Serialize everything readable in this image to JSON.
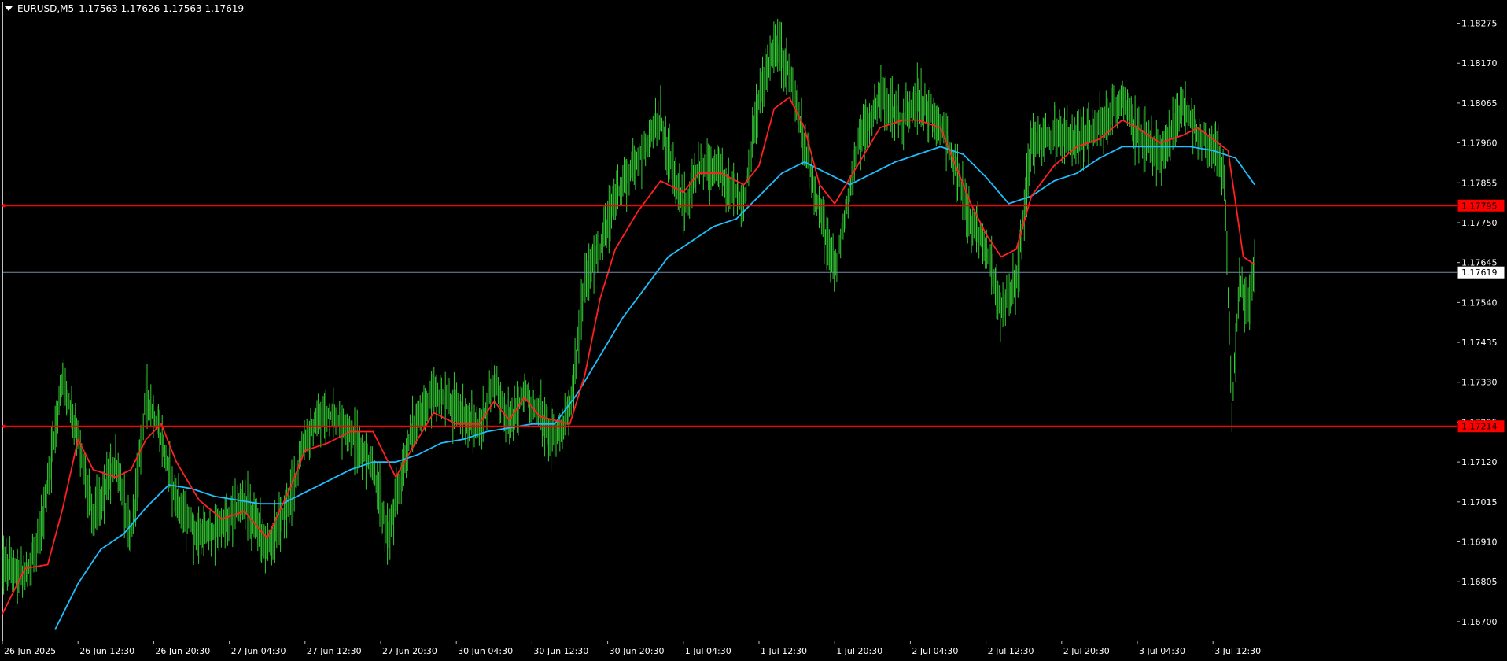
{
  "header": {
    "symbol": "EURUSD,M5",
    "ohlc": "1.17563 1.17626 1.17563 1.17619"
  },
  "colors": {
    "background": "#000000",
    "axis": "#c0c0c0",
    "candle": "#32cd32",
    "fast_ma": "#ff2020",
    "slow_ma": "#1ebeff",
    "hline": "#ff0000",
    "bid_line": "#6e8ca8"
  },
  "price_axis": {
    "labels": [
      "1.18275",
      "1.18170",
      "1.18065",
      "1.17960",
      "1.17855",
      "1.17750",
      "1.17645",
      "1.17540",
      "1.17435",
      "1.17330",
      "1.17225",
      "1.17120",
      "1.17015",
      "1.16910",
      "1.16805",
      "1.16700"
    ]
  },
  "time_axis": {
    "labels": [
      "26 Jun 2025",
      "26 Jun 12:30",
      "26 Jun 20:30",
      "27 Jun 04:30",
      "27 Jun 12:30",
      "27 Jun 20:30",
      "30 Jun 04:30",
      "30 Jun 12:30",
      "30 Jun 20:30",
      "1 Jul 04:30",
      "1 Jul 12:30",
      "1 Jul 20:30",
      "2 Jul 04:30",
      "2 Jul 12:30",
      "2 Jul 20:30",
      "3 Jul 04:30",
      "3 Jul 12:30"
    ]
  },
  "levels": {
    "resistance": "1.17795",
    "support": "1.17214",
    "bid": "1.17619"
  },
  "chart_data": {
    "type": "line",
    "symbol": "EURUSD",
    "timeframe": "M5",
    "ylim": [
      1.1665,
      1.1833
    ],
    "x_ticks": [
      "26 Jun 2025",
      "26 Jun 12:30",
      "26 Jun 20:30",
      "27 Jun 04:30",
      "27 Jun 12:30",
      "27 Jun 20:30",
      "30 Jun 04:30",
      "30 Jun 12:30",
      "30 Jun 20:30",
      "1 Jul 04:30",
      "1 Jul 12:30",
      "1 Jul 20:30",
      "2 Jul 04:30",
      "2 Jul 12:30",
      "2 Jul 20:30",
      "3 Jul 04:30",
      "3 Jul 12:30"
    ],
    "x_start_tick": 0,
    "x_end_tick": 16.55,
    "series": [
      {
        "role": "price",
        "points": [
          [
            0,
            1.1685
          ],
          [
            0.3,
            1.1682
          ],
          [
            0.5,
            1.1692
          ],
          [
            0.8,
            1.1735
          ],
          [
            1.0,
            1.1718
          ],
          [
            1.2,
            1.1698
          ],
          [
            1.5,
            1.1712
          ],
          [
            1.7,
            1.1692
          ],
          [
            1.9,
            1.173
          ],
          [
            2.1,
            1.1718
          ],
          [
            2.3,
            1.1702
          ],
          [
            2.6,
            1.1692
          ],
          [
            2.9,
            1.1695
          ],
          [
            3.2,
            1.1702
          ],
          [
            3.5,
            1.169
          ],
          [
            3.8,
            1.1702
          ],
          [
            4.0,
            1.1718
          ],
          [
            4.3,
            1.1725
          ],
          [
            4.6,
            1.172
          ],
          [
            4.9,
            1.171
          ],
          [
            5.1,
            1.1692
          ],
          [
            5.4,
            1.172
          ],
          [
            5.7,
            1.173
          ],
          [
            6.0,
            1.1726
          ],
          [
            6.3,
            1.172
          ],
          [
            6.5,
            1.1734
          ],
          [
            6.7,
            1.1722
          ],
          [
            6.9,
            1.173
          ],
          [
            7.1,
            1.1725
          ],
          [
            7.3,
            1.1718
          ],
          [
            7.5,
            1.1725
          ],
          [
            7.7,
            1.176
          ],
          [
            7.9,
            1.1768
          ],
          [
            8.1,
            1.1782
          ],
          [
            8.4,
            1.1792
          ],
          [
            8.7,
            1.1802
          ],
          [
            9.0,
            1.1778
          ],
          [
            9.2,
            1.179
          ],
          [
            9.5,
            1.1788
          ],
          [
            9.8,
            1.178
          ],
          [
            10.0,
            1.1808
          ],
          [
            10.2,
            1.1822
          ],
          [
            10.4,
            1.1815
          ],
          [
            10.6,
            1.1795
          ],
          [
            10.8,
            1.1778
          ],
          [
            11.0,
            1.1762
          ],
          [
            11.3,
            1.1795
          ],
          [
            11.6,
            1.1808
          ],
          [
            11.9,
            1.1802
          ],
          [
            12.1,
            1.1808
          ],
          [
            12.4,
            1.18
          ],
          [
            12.6,
            1.179
          ],
          [
            12.8,
            1.1775
          ],
          [
            13.0,
            1.1768
          ],
          [
            13.2,
            1.1752
          ],
          [
            13.4,
            1.176
          ],
          [
            13.6,
            1.1795
          ],
          [
            13.9,
            1.1798
          ],
          [
            14.2,
            1.1796
          ],
          [
            14.5,
            1.18
          ],
          [
            14.8,
            1.1808
          ],
          [
            15.0,
            1.1798
          ],
          [
            15.3,
            1.1792
          ],
          [
            15.6,
            1.1806
          ],
          [
            15.8,
            1.1798
          ],
          [
            16.0,
            1.1795
          ],
          [
            16.15,
            1.1788
          ],
          [
            16.25,
            1.1725
          ],
          [
            16.35,
            1.176
          ],
          [
            16.45,
            1.1752
          ],
          [
            16.55,
            1.1762
          ]
        ]
      },
      {
        "role": "fast-ma",
        "points": [
          [
            0,
            1.1672
          ],
          [
            0.3,
            1.1684
          ],
          [
            0.6,
            1.1685
          ],
          [
            0.8,
            1.17
          ],
          [
            1.0,
            1.1718
          ],
          [
            1.2,
            1.171
          ],
          [
            1.5,
            1.1708
          ],
          [
            1.7,
            1.171
          ],
          [
            1.9,
            1.1718
          ],
          [
            2.1,
            1.1722
          ],
          [
            2.3,
            1.1712
          ],
          [
            2.6,
            1.1702
          ],
          [
            2.9,
            1.1697
          ],
          [
            3.2,
            1.1699
          ],
          [
            3.5,
            1.1692
          ],
          [
            3.8,
            1.1705
          ],
          [
            4.0,
            1.1715
          ],
          [
            4.3,
            1.1717
          ],
          [
            4.6,
            1.172
          ],
          [
            4.9,
            1.172
          ],
          [
            5.2,
            1.1708
          ],
          [
            5.4,
            1.1715
          ],
          [
            5.7,
            1.1725
          ],
          [
            6.0,
            1.1722
          ],
          [
            6.3,
            1.1722
          ],
          [
            6.5,
            1.1728
          ],
          [
            6.7,
            1.1723
          ],
          [
            6.9,
            1.1729
          ],
          [
            7.1,
            1.1724
          ],
          [
            7.3,
            1.1723
          ],
          [
            7.5,
            1.1722
          ],
          [
            7.7,
            1.1735
          ],
          [
            7.9,
            1.1755
          ],
          [
            8.1,
            1.1768
          ],
          [
            8.4,
            1.1778
          ],
          [
            8.7,
            1.1786
          ],
          [
            9.0,
            1.1783
          ],
          [
            9.2,
            1.1788
          ],
          [
            9.5,
            1.1788
          ],
          [
            9.8,
            1.1785
          ],
          [
            10.0,
            1.179
          ],
          [
            10.2,
            1.1805
          ],
          [
            10.4,
            1.1808
          ],
          [
            10.6,
            1.18
          ],
          [
            10.8,
            1.1785
          ],
          [
            11.0,
            1.178
          ],
          [
            11.3,
            1.179
          ],
          [
            11.6,
            1.18
          ],
          [
            11.9,
            1.1802
          ],
          [
            12.1,
            1.1802
          ],
          [
            12.4,
            1.18
          ],
          [
            12.6,
            1.179
          ],
          [
            12.8,
            1.178
          ],
          [
            13.0,
            1.1772
          ],
          [
            13.2,
            1.1766
          ],
          [
            13.4,
            1.1768
          ],
          [
            13.6,
            1.1782
          ],
          [
            13.9,
            1.179
          ],
          [
            14.2,
            1.1795
          ],
          [
            14.5,
            1.1797
          ],
          [
            14.8,
            1.1802
          ],
          [
            15.0,
            1.18
          ],
          [
            15.3,
            1.1796
          ],
          [
            15.6,
            1.1798
          ],
          [
            15.8,
            1.18
          ],
          [
            16.0,
            1.1797
          ],
          [
            16.2,
            1.1794
          ],
          [
            16.4,
            1.1766
          ],
          [
            16.55,
            1.1764
          ]
        ]
      },
      {
        "role": "slow-ma",
        "points": [
          [
            0.7,
            1.1668
          ],
          [
            1.0,
            1.168
          ],
          [
            1.3,
            1.1689
          ],
          [
            1.6,
            1.1693
          ],
          [
            1.9,
            1.17
          ],
          [
            2.2,
            1.1706
          ],
          [
            2.5,
            1.1705
          ],
          [
            2.8,
            1.1703
          ],
          [
            3.1,
            1.1702
          ],
          [
            3.4,
            1.1701
          ],
          [
            3.7,
            1.1701
          ],
          [
            4.0,
            1.1704
          ],
          [
            4.3,
            1.1707
          ],
          [
            4.6,
            1.171
          ],
          [
            4.9,
            1.1712
          ],
          [
            5.2,
            1.1712
          ],
          [
            5.5,
            1.1714
          ],
          [
            5.8,
            1.1717
          ],
          [
            6.1,
            1.1718
          ],
          [
            6.4,
            1.172
          ],
          [
            6.7,
            1.1721
          ],
          [
            7.0,
            1.1722
          ],
          [
            7.3,
            1.1722
          ],
          [
            7.6,
            1.173
          ],
          [
            7.9,
            1.174
          ],
          [
            8.2,
            1.175
          ],
          [
            8.5,
            1.1758
          ],
          [
            8.8,
            1.1766
          ],
          [
            9.1,
            1.177
          ],
          [
            9.4,
            1.1774
          ],
          [
            9.7,
            1.1776
          ],
          [
            10.0,
            1.1782
          ],
          [
            10.3,
            1.1788
          ],
          [
            10.6,
            1.1791
          ],
          [
            10.9,
            1.1788
          ],
          [
            11.2,
            1.1785
          ],
          [
            11.5,
            1.1788
          ],
          [
            11.8,
            1.1791
          ],
          [
            12.1,
            1.1793
          ],
          [
            12.4,
            1.1795
          ],
          [
            12.7,
            1.1793
          ],
          [
            13.0,
            1.1787
          ],
          [
            13.3,
            1.178
          ],
          [
            13.6,
            1.1782
          ],
          [
            13.9,
            1.1786
          ],
          [
            14.2,
            1.1788
          ],
          [
            14.5,
            1.1792
          ],
          [
            14.8,
            1.1795
          ],
          [
            15.1,
            1.1795
          ],
          [
            15.4,
            1.1795
          ],
          [
            15.7,
            1.1795
          ],
          [
            16.0,
            1.1794
          ],
          [
            16.3,
            1.1792
          ],
          [
            16.55,
            1.1785
          ]
        ]
      }
    ],
    "horizontal_lines": [
      {
        "name": "resistance",
        "value": 1.17795
      },
      {
        "name": "support",
        "value": 1.17214
      },
      {
        "name": "bid",
        "value": 1.17619
      }
    ]
  }
}
